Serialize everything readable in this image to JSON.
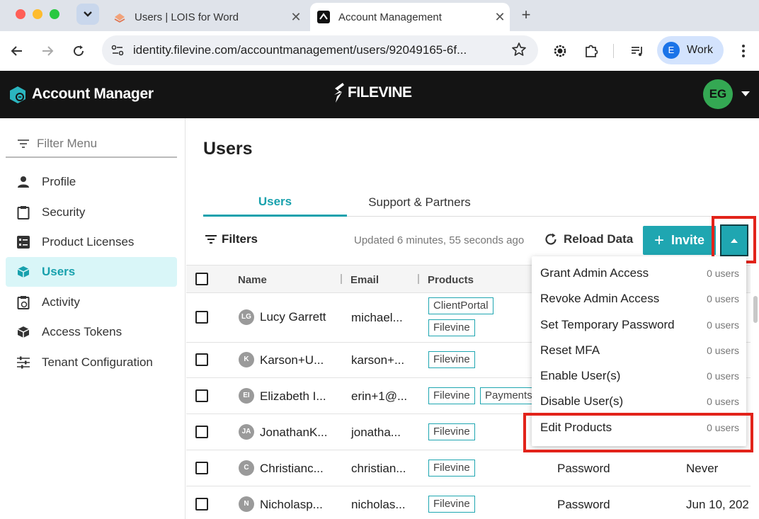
{
  "browser": {
    "tabs": [
      {
        "title": "Users | LOIS for Word",
        "active": false
      },
      {
        "title": "Account Management",
        "active": true
      }
    ],
    "url": "identity.filevine.com/accountmanagement/users/92049165-6f...",
    "profile_initial": "E",
    "profile_label": "Work"
  },
  "header": {
    "app_name": "Account Manager",
    "brand": "FILEVINE",
    "user_initials": "EG",
    "colors": {
      "header_bg": "#141414",
      "avatar_bg": "#34a853"
    }
  },
  "sidebar": {
    "filter_placeholder": "Filter Menu",
    "items": [
      {
        "label": "Profile",
        "icon": "person-icon",
        "active": false
      },
      {
        "label": "Security",
        "icon": "clipboard-icon",
        "active": false
      },
      {
        "label": "Product Licenses",
        "icon": "list-box-icon",
        "active": false
      },
      {
        "label": "Users",
        "icon": "cube-icon",
        "active": true
      },
      {
        "label": "Activity",
        "icon": "clipboard-clock-icon",
        "active": false
      },
      {
        "label": "Access Tokens",
        "icon": "cube-token-icon",
        "active": false
      },
      {
        "label": "Tenant Configuration",
        "icon": "sliders-icon",
        "active": false
      }
    ]
  },
  "main": {
    "title": "Users",
    "tabs": [
      {
        "label": "Users",
        "active": true
      },
      {
        "label": "Support & Partners",
        "active": false
      }
    ],
    "filters_label": "Filters",
    "updated_text": "Updated 6 minutes, 55 seconds ago",
    "reload_label": "Reload Data",
    "invite_label": "Invite",
    "accent_color": "#1fa6b1",
    "highlight_color": "#e2231a"
  },
  "table": {
    "columns": [
      "Name",
      "Email",
      "Products"
    ],
    "rows": [
      {
        "initials": "LG",
        "name": "Lucy Garrett",
        "email": "michael...",
        "products": [
          "ClientPortal",
          "Filevine"
        ],
        "auth": "",
        "last_login": ""
      },
      {
        "initials": "K",
        "name": "Karson+U...",
        "email": "karson+...",
        "products": [
          "Filevine"
        ],
        "auth": "",
        "last_login": ""
      },
      {
        "initials": "EI",
        "name": "Elizabeth I...",
        "email": "erin+1@...",
        "products": [
          "Filevine",
          "Payments"
        ],
        "auth": "",
        "last_login": ""
      },
      {
        "initials": "JA",
        "name": "JonathanK...",
        "email": "jonatha...",
        "products": [
          "Filevine"
        ],
        "auth": "",
        "last_login": ""
      },
      {
        "initials": "C",
        "name": "Christianc...",
        "email": "christian...",
        "products": [
          "Filevine"
        ],
        "auth": "Password",
        "last_login": "Never"
      },
      {
        "initials": "N",
        "name": "Nicholasp...",
        "email": "nicholas...",
        "products": [
          "Filevine"
        ],
        "auth": "Password",
        "last_login": "Jun 10, 202"
      }
    ]
  },
  "bulk_menu": {
    "items": [
      {
        "label": "Grant Admin Access",
        "count": "0 users"
      },
      {
        "label": "Revoke Admin Access",
        "count": "0 users"
      },
      {
        "label": "Set Temporary Password",
        "count": "0 users"
      },
      {
        "label": "Reset MFA",
        "count": "0 users"
      },
      {
        "label": "Enable User(s)",
        "count": "0 users"
      },
      {
        "label": "Disable User(s)",
        "count": "0 users"
      },
      {
        "label": "Edit Products",
        "count": "0 users"
      }
    ]
  }
}
